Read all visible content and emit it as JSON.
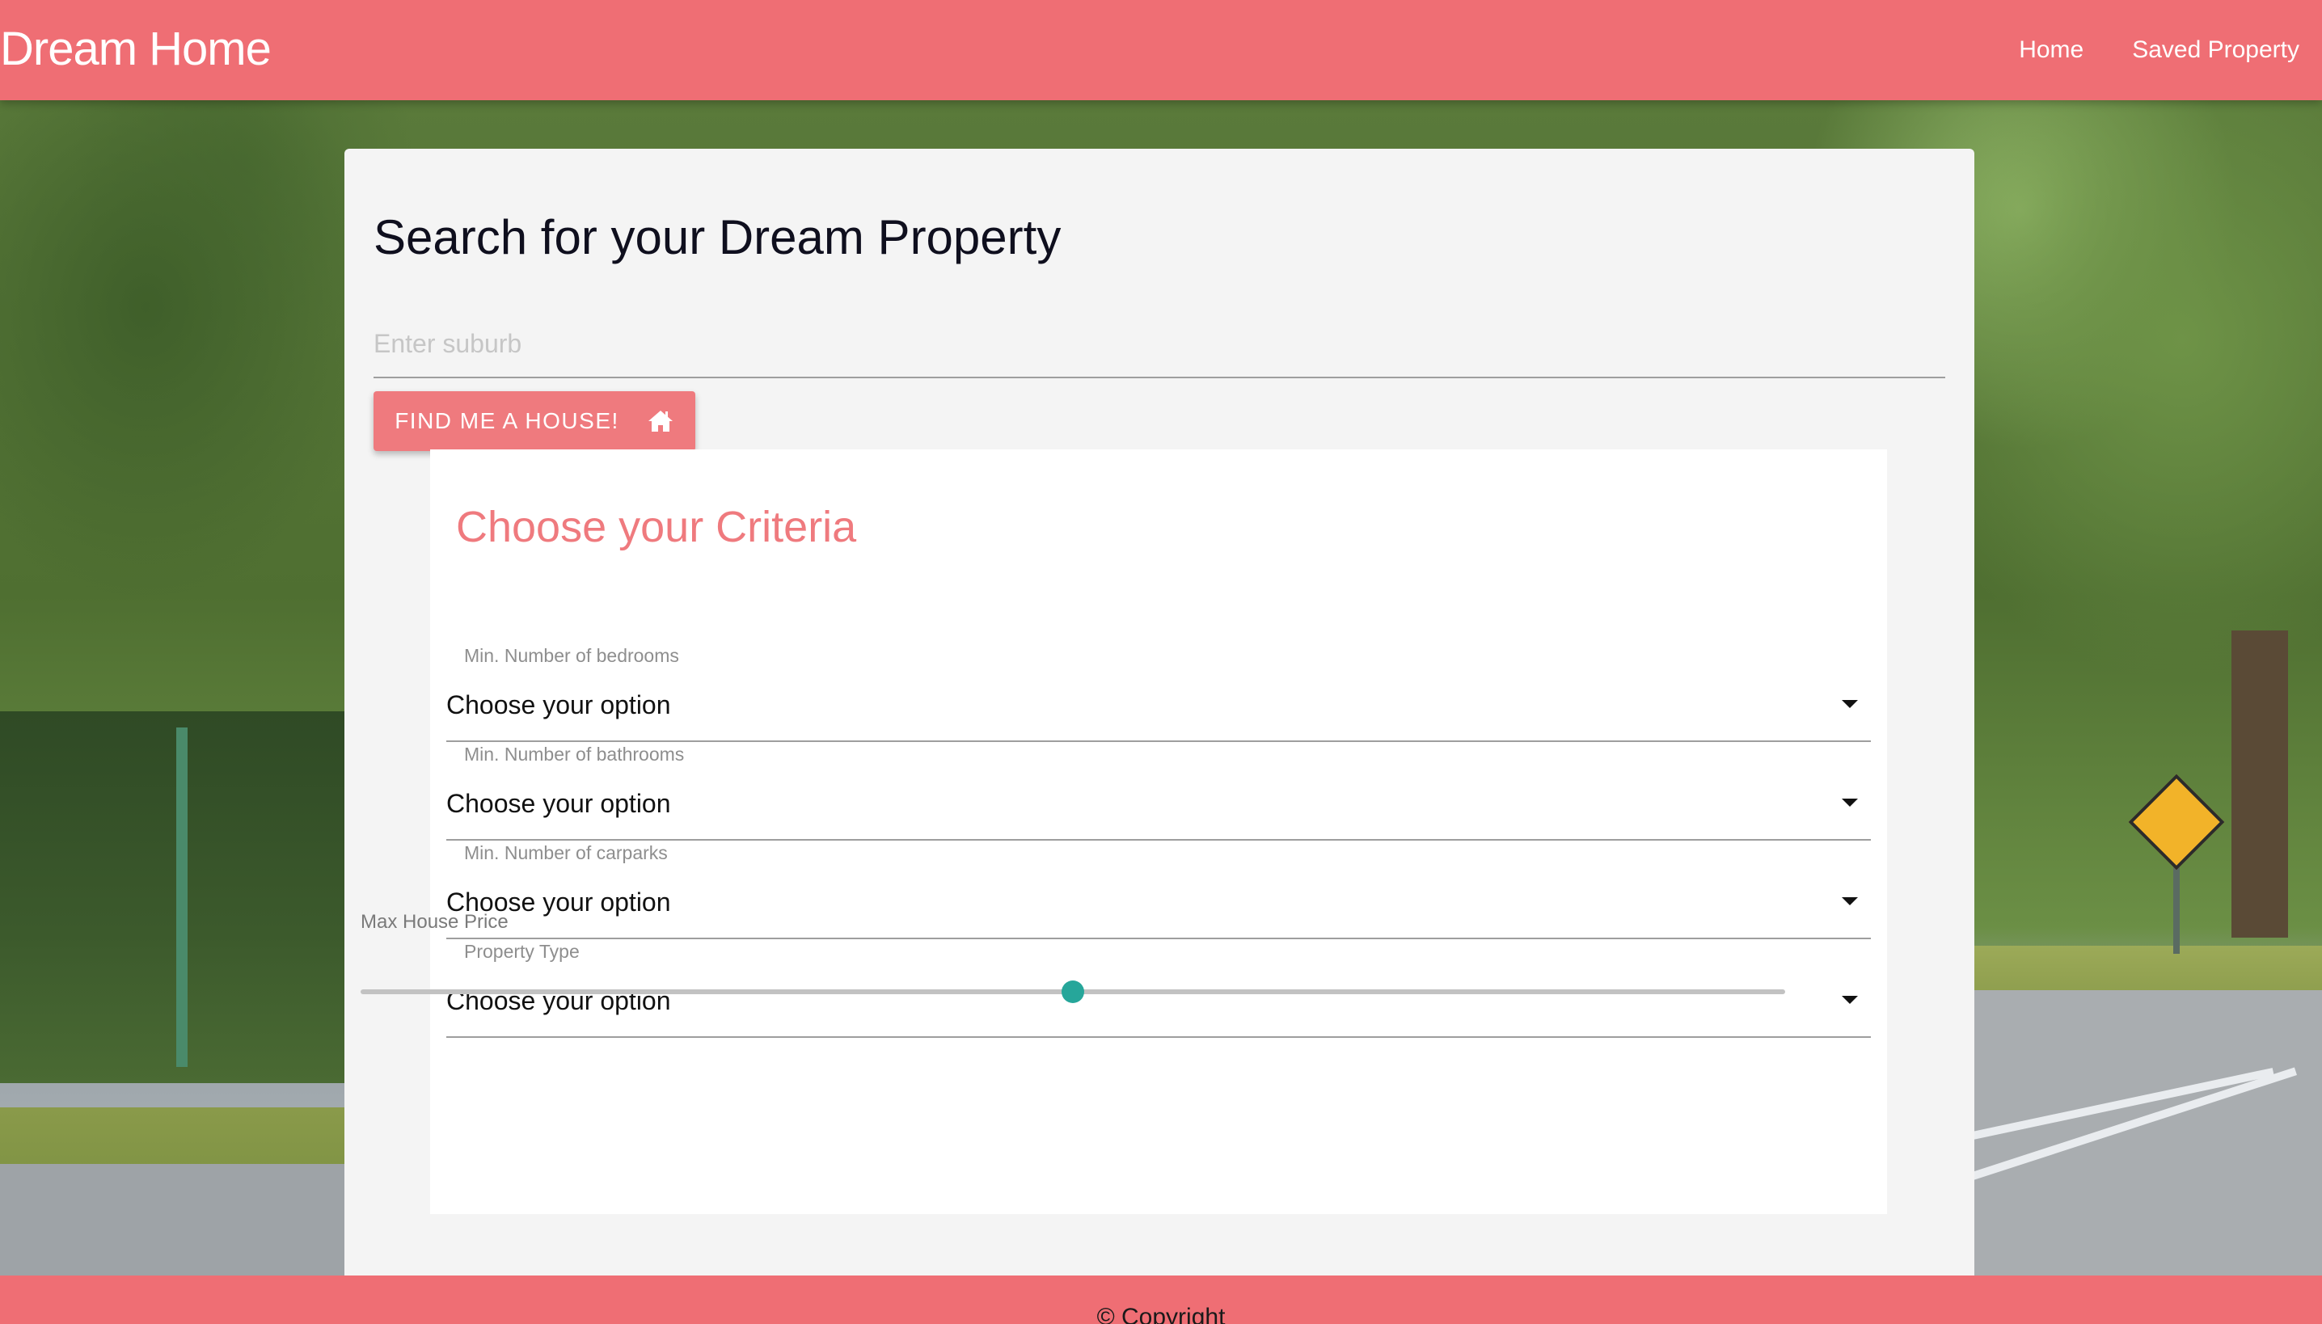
{
  "navbar": {
    "brand": "Dream Home",
    "links": [
      "Home",
      "Saved Property"
    ],
    "color": "#ef6e74"
  },
  "search": {
    "title": "Search for your Dream Property",
    "placeholder": "Enter suburb",
    "button_label": "FIND ME A HOUSE!",
    "button_icon": "home-icon"
  },
  "criteria": {
    "title": "Choose your Criteria",
    "title_color": "#ef7a7e",
    "fields": [
      {
        "label": "Min. Number of bedrooms",
        "value": "Choose your option"
      },
      {
        "label": "Min. Number of bathrooms",
        "value": "Choose your option"
      },
      {
        "label": "Min. Number of carparks",
        "value": "Choose your option"
      },
      {
        "label": "Property Type",
        "value": "Choose your option"
      }
    ],
    "price_label": "Max House Price",
    "slider": {
      "fraction": 0.5,
      "thumb_color": "#26a69a"
    }
  },
  "footer": {
    "copyright": "© Copyright"
  }
}
